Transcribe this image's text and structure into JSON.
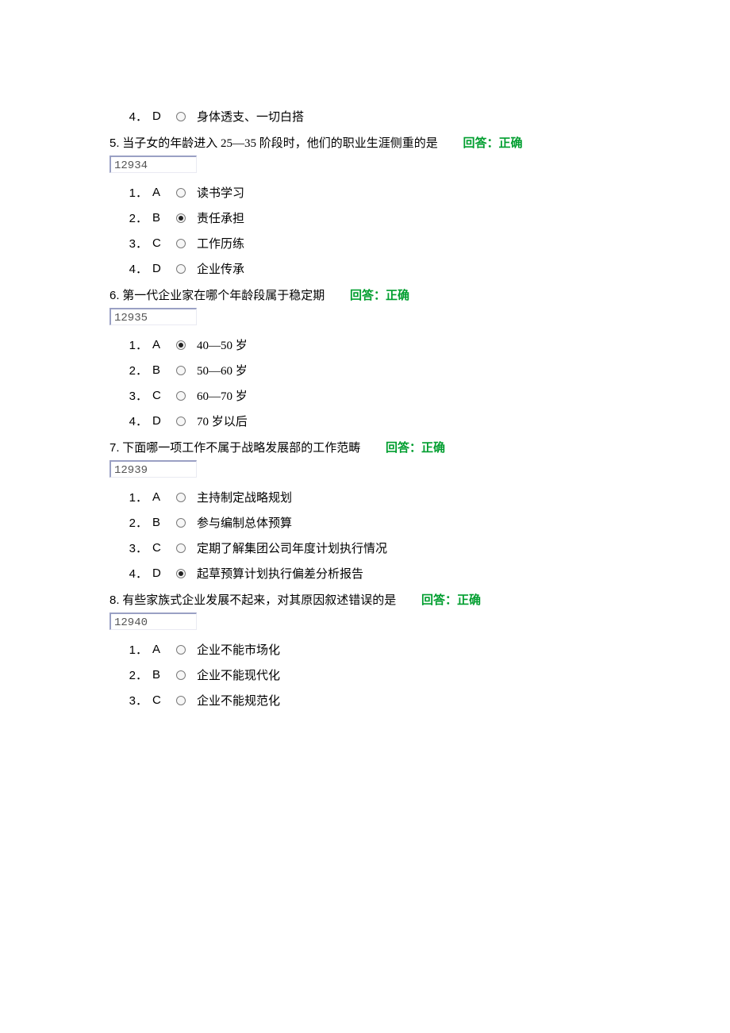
{
  "q4_prev": {
    "options": [
      {
        "num": "4．",
        "letter": "D",
        "text": "身体透支、一切白搭",
        "selected": false
      }
    ]
  },
  "q5": {
    "num": "5.",
    "text": "当子女的年龄进入 25—35 阶段时，他们的职业生涯侧重的是",
    "feedback": "回答：正确",
    "boxid": "12934",
    "options": [
      {
        "num": "1．",
        "letter": "A",
        "text": "读书学习",
        "selected": false
      },
      {
        "num": "2．",
        "letter": "B",
        "text": "责任承担",
        "selected": true
      },
      {
        "num": "3．",
        "letter": "C",
        "text": "工作历练",
        "selected": false
      },
      {
        "num": "4．",
        "letter": "D",
        "text": "企业传承",
        "selected": false
      }
    ]
  },
  "q6": {
    "num": "6.",
    "text": "第一代企业家在哪个年龄段属于稳定期",
    "feedback": "回答：正确",
    "boxid": "12935",
    "options": [
      {
        "num": "1．",
        "letter": "A",
        "text": "40—50 岁",
        "selected": true
      },
      {
        "num": "2．",
        "letter": "B",
        "text": "50—60 岁",
        "selected": false
      },
      {
        "num": "3．",
        "letter": "C",
        "text": "60—70 岁",
        "selected": false
      },
      {
        "num": "4．",
        "letter": "D",
        "text": "70 岁以后",
        "selected": false
      }
    ]
  },
  "q7": {
    "num": "7.",
    "text": "下面哪一项工作不属于战略发展部的工作范畴",
    "feedback": "回答：正确",
    "boxid": "12939",
    "options": [
      {
        "num": "1．",
        "letter": "A",
        "text": "主持制定战略规划",
        "selected": false
      },
      {
        "num": "2．",
        "letter": "B",
        "text": "参与编制总体预算",
        "selected": false
      },
      {
        "num": "3．",
        "letter": "C",
        "text": "定期了解集团公司年度计划执行情况",
        "selected": false
      },
      {
        "num": "4．",
        "letter": "D",
        "text": "起草预算计划执行偏差分析报告",
        "selected": true
      }
    ]
  },
  "q8": {
    "num": "8.",
    "text": " 有些家族式企业发展不起来，对其原因叙述错误的是",
    "feedback": "回答：正确",
    "boxid": "12940",
    "options": [
      {
        "num": "1．",
        "letter": "A",
        "text": "企业不能市场化",
        "selected": false
      },
      {
        "num": "2．",
        "letter": "B",
        "text": "企业不能现代化",
        "selected": false
      },
      {
        "num": "3．",
        "letter": "C",
        "text": "企业不能规范化",
        "selected": false
      }
    ]
  }
}
